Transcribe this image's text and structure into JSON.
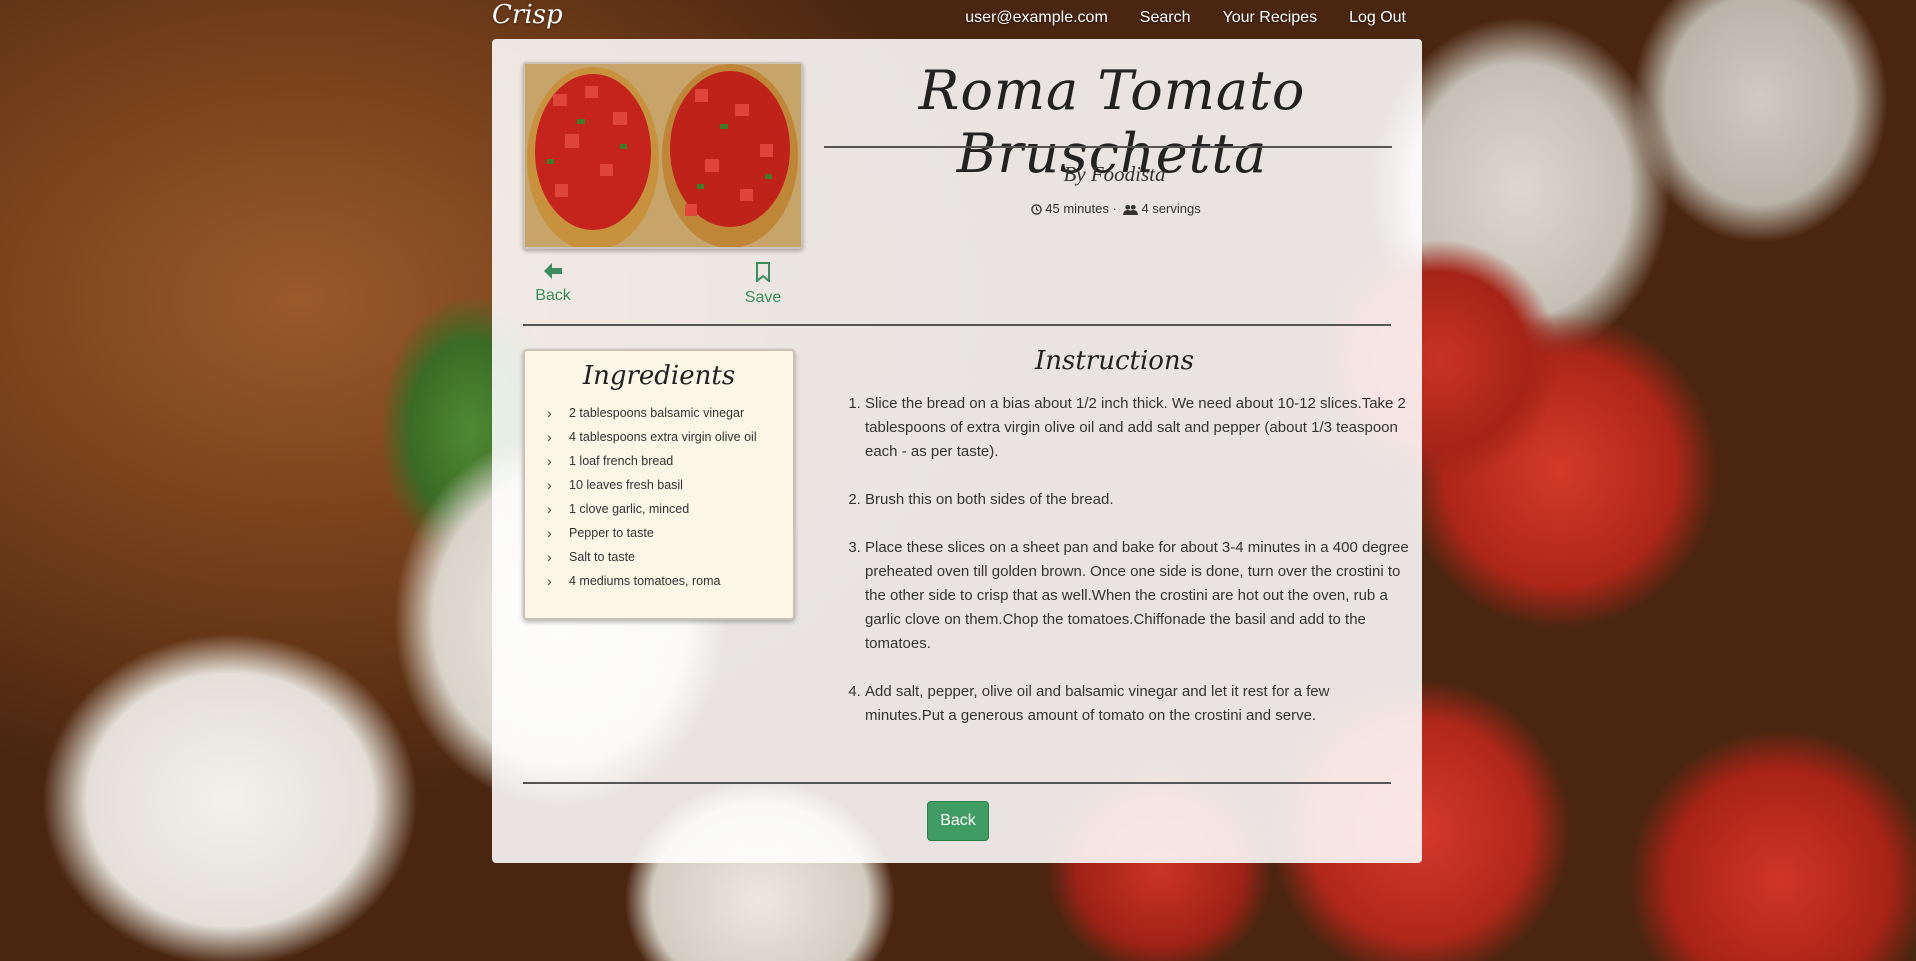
{
  "nav": {
    "brand": "Crisp",
    "links": [
      "user@example.com",
      "Search",
      "Your Recipes",
      "Log Out"
    ]
  },
  "recipe": {
    "title": "Roma Tomato Bruschetta",
    "author": "By Foodista",
    "time": "45 minutes",
    "separator": "·",
    "servings": "4 servings"
  },
  "actions": {
    "back_label": "Back",
    "save_label": "Save"
  },
  "ingredients": {
    "title": "Ingredients",
    "items": [
      "2 tablespoons balsamic vinegar",
      "4 tablespoons extra virgin olive oil",
      "1 loaf french bread",
      "10 leaves fresh basil",
      "1 clove garlic, minced",
      "Pepper to taste",
      "Salt to taste",
      "4 mediums tomatoes, roma"
    ]
  },
  "instructions": {
    "title": "Instructions",
    "steps": [
      "Slice the bread on a bias about 1/2 inch thick. We need about 10-12 slices.Take 2 tablespoons of extra virgin olive oil and add salt and pepper (about 1/3 teaspoon each - as per taste).",
      "Brush this on both sides of the bread.",
      "Place these slices on a sheet pan and bake for about 3-4 minutes in a 400 degree preheated oven till golden brown. Once one side is done, turn over the crostini to the other side to crisp that as well.When the crostini are hot out the oven, rub a garlic clove on them.Chop the tomatoes.Chiffonade the basil and add to the tomatoes.",
      "Add salt, pepper, olive oil and balsamic vinegar and let it rest for a few minutes.Put a generous amount of tomato on the crostini and serve."
    ]
  },
  "footer": {
    "back_button": "Back"
  },
  "colors": {
    "accent": "#3f9c62",
    "link": "#3f8d5f",
    "ingredients_bg": "#fdf5e6"
  }
}
